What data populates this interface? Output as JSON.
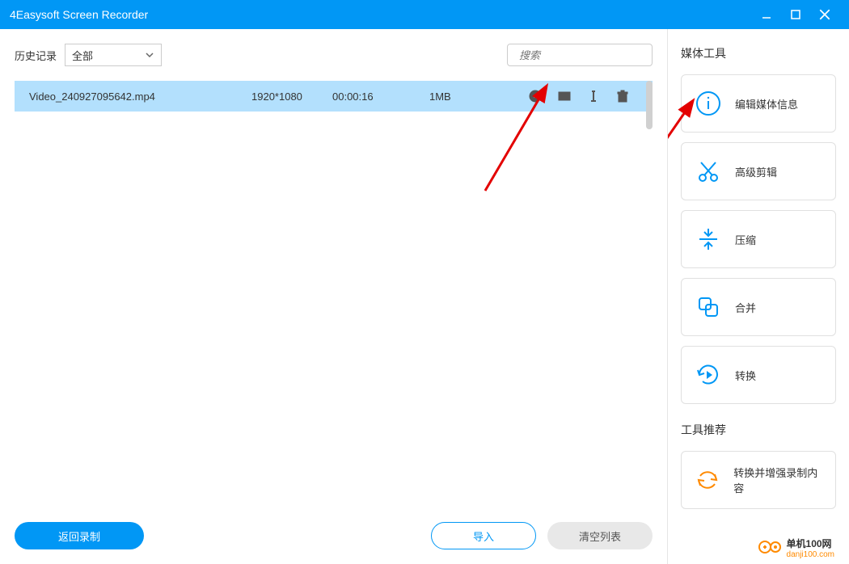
{
  "titlebar": {
    "title": "4Easysoft Screen Recorder"
  },
  "toolbar": {
    "history_label": "历史记录",
    "filter_value": "全部",
    "search_placeholder": "搜索"
  },
  "list": {
    "rows": [
      {
        "name": "Video_240927095642.mp4",
        "resolution": "1920*1080",
        "duration": "00:00:16",
        "size": "1MB"
      }
    ]
  },
  "bottom": {
    "back_label": "返回录制",
    "import_label": "导入",
    "clear_label": "清空列表"
  },
  "sidebar": {
    "media_tools_title": "媒体工具",
    "tools": [
      {
        "label": "编辑媒体信息",
        "icon": "info"
      },
      {
        "label": "高级剪辑",
        "icon": "scissors"
      },
      {
        "label": "压缩",
        "icon": "compress"
      },
      {
        "label": "合并",
        "icon": "merge"
      },
      {
        "label": "转换",
        "icon": "convert"
      }
    ],
    "recommend_title": "工具推荐",
    "recommend": [
      {
        "label": "转换并增强录制内容",
        "icon": "refresh"
      }
    ]
  },
  "watermark": {
    "text1": "单机100网",
    "text2": "danji100.com"
  }
}
